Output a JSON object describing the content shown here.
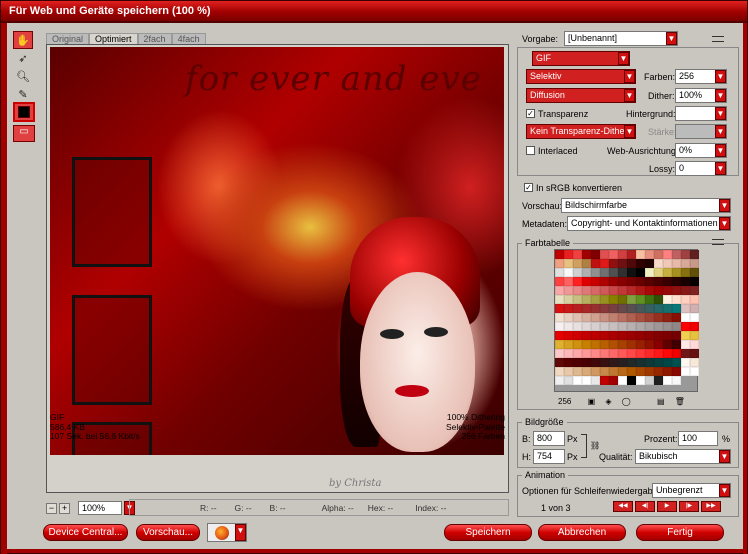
{
  "window": {
    "title": "Für Web und Geräte speichern (100 %)"
  },
  "tabs": [
    "Original",
    "Optimiert",
    "2fach",
    "4fach"
  ],
  "tools": [
    "hand-icon",
    "slice-select-icon",
    "zoom-icon",
    "eyedropper-icon",
    "color-well",
    "toggle-slices-icon"
  ],
  "preview": {
    "image_text": "for ever and eve",
    "info_left": [
      "GIF",
      "586,4 KB",
      "107 Sek. bei 56,6 Kbit/s"
    ],
    "info_right": [
      "100% Dithering",
      "Selektiv-Palette",
      "256 Farben"
    ],
    "signature": "by Christa"
  },
  "zoom": {
    "value": "100%"
  },
  "pixel_info": {
    "r": "R: --",
    "g": "G: --",
    "b": "B: --",
    "alpha": "Alpha: --",
    "hex": "Hex: --",
    "index": "Index: --"
  },
  "buttons": {
    "device_central": "Device Central...",
    "preview": "Vorschau...",
    "save": "Speichern",
    "cancel": "Abbrechen",
    "done": "Fertig"
  },
  "settings": {
    "preset_label": "Vorgabe:",
    "preset_value": "[Unbenannt]",
    "format": "GIF",
    "reduction": "Selektiv",
    "colors_label": "Farben:",
    "colors_value": "256",
    "dither_algo": "Diffusion",
    "dither_label": "Dither:",
    "dither_value": "100%",
    "transparency_label": "Transparenz",
    "transparency_checked": true,
    "matte_label": "Hintergrund:",
    "transp_dither": "Kein Transparenz-Dither",
    "amount_label": "Stärke:",
    "interlaced_label": "Interlaced",
    "interlaced_checked": false,
    "web_snap_label": "Web-Ausrichtung:",
    "web_snap_value": "0%",
    "lossy_label": "Lossy:",
    "lossy_value": "0",
    "srgb_label": "In sRGB konvertieren",
    "srgb_checked": true,
    "preview_label": "Vorschau:",
    "preview_value": "Bildschirmfarbe",
    "metadata_label": "Metadaten:",
    "metadata_value": "Copyright- und Kontaktinformationen"
  },
  "color_table": {
    "title": "Farbtabelle",
    "count": "256",
    "colors": [
      "#c00000",
      "#e82020",
      "#f04040",
      "#a00000",
      "#800000",
      "#e05050",
      "#f06060",
      "#d04040",
      "#b02020",
      "#f8c0a0",
      "#e89080",
      "#d07060",
      "#ff8080",
      "#c06060",
      "#a04040",
      "#602020",
      "#f0a080",
      "#e8c080",
      "#d0a060",
      "#b08040",
      "#c01010",
      "#e01818",
      "#901010",
      "#701010",
      "#500808",
      "#300000",
      "#200000",
      "#f8d8c8",
      "#f0c8b8",
      "#e8b8a8",
      "#d8a898",
      "#c89888",
      "#e0e0e0",
      "#f8f8f8",
      "#d0d0d0",
      "#b0b0b0",
      "#909090",
      "#707070",
      "#505050",
      "#303030",
      "#101010",
      "#000000",
      "#f0f0c0",
      "#e0d080",
      "#c8b040",
      "#a89020",
      "#887010",
      "#605008",
      "#ff4040",
      "#ff6060",
      "#ff2020",
      "#e00000",
      "#c80000",
      "#b00000",
      "#980000",
      "#880000",
      "#780000",
      "#680000",
      "#580000",
      "#480000",
      "#380000",
      "#280000",
      "#180000",
      "#080000",
      "#f8a8a8",
      "#f09898",
      "#e88888",
      "#e07878",
      "#d86868",
      "#d05858",
      "#c84848",
      "#c03838",
      "#b82828",
      "#b01818",
      "#a80808",
      "#a00000",
      "#980808",
      "#901010",
      "#881818",
      "#802020",
      "#e8e0c0",
      "#d8d0a0",
      "#c8c080",
      "#b8b060",
      "#a8a040",
      "#989020",
      "#888000",
      "#707000",
      "#80a040",
      "#609020",
      "#407010",
      "#305008",
      "#fff0e0",
      "#ffe0d0",
      "#ffd0c0",
      "#ffc0b0",
      "#d81010",
      "#c81818",
      "#b82020",
      "#a82828",
      "#983030",
      "#883838",
      "#784040",
      "#684848",
      "#585050",
      "#485858",
      "#386060",
      "#286868",
      "#187070",
      "#087878",
      "#e0c0c0",
      "#d0b0b0",
      "#f0e0d0",
      "#e8d0c0",
      "#e0c0b0",
      "#d8b0a0",
      "#d0a090",
      "#c89080",
      "#c08070",
      "#b87060",
      "#b06050",
      "#a85040",
      "#a04030",
      "#983020",
      "#902010",
      "#881000",
      "#ffffff",
      "#fefefe",
      "#f8f0f0",
      "#f0e8e8",
      "#e8e0e0",
      "#e0d8d8",
      "#d8d0d0",
      "#d0c8c8",
      "#c8c0c0",
      "#c0b8b8",
      "#b8b0b0",
      "#b0a8a8",
      "#a8a0a0",
      "#a09898",
      "#989090",
      "#908888",
      "#ff0000",
      "#f00000",
      "#e80000",
      "#d80000",
      "#d00000",
      "#c40000",
      "#bc0000",
      "#b40000",
      "#ac0000",
      "#a40000",
      "#9c0000",
      "#940000",
      "#8c0000",
      "#840000",
      "#7c0000",
      "#740000",
      "#f0d050",
      "#e8c040",
      "#e0b030",
      "#d8a020",
      "#d09010",
      "#c88000",
      "#c07000",
      "#b86000",
      "#b05000",
      "#a84000",
      "#a03000",
      "#982000",
      "#901000",
      "#880000",
      "#600000",
      "#400000",
      "#ffe8e8",
      "#ffd8d8",
      "#ffc8c8",
      "#ffb8b8",
      "#ffa8a8",
      "#ff9898",
      "#ff8888",
      "#ff7878",
      "#ff6868",
      "#ff5858",
      "#ff4848",
      "#ff3838",
      "#ff2828",
      "#ff1818",
      "#ff0808",
      "#ee0000",
      "#701818",
      "#681010",
      "#600808",
      "#580000",
      "#500000",
      "#480000",
      "#400808",
      "#381010",
      "#301818",
      "#282020",
      "#202828",
      "#183030",
      "#103838",
      "#084040",
      "#004848",
      "#005050",
      "#fff8f0",
      "#f8e8d8",
      "#f0d8c0",
      "#e8c8a8",
      "#e0b890",
      "#d8a878",
      "#d09860",
      "#c88848",
      "#c07830",
      "#b86818",
      "#b05800",
      "#a84800",
      "#a03800",
      "#982800",
      "#901800",
      "#880800",
      "#ffffff",
      "#ffffff",
      "#f0f0f0",
      "#e0e0e0",
      "#ffffff",
      "#ffffff",
      "#e8e8e8",
      "#c00000",
      "#a00000",
      "#ffffff",
      "#000000",
      "#ffffff",
      "#d0d0d0",
      "#202020",
      "#ffffff",
      "#f8f8f8"
    ]
  },
  "image_size": {
    "title": "Bildgröße",
    "w_label": "B:",
    "w_value": "800",
    "w_unit": "Px",
    "h_label": "H:",
    "h_value": "754",
    "h_unit": "Px",
    "percent_label": "Prozent:",
    "percent_value": "100",
    "percent_unit": "%",
    "quality_label": "Qualität:",
    "quality_value": "Bikubisch"
  },
  "animation": {
    "title": "Animation",
    "loop_label": "Optionen für Schleifenwiedergabe:",
    "loop_value": "Unbegrenzt",
    "frame_counter": "1 von 3"
  }
}
